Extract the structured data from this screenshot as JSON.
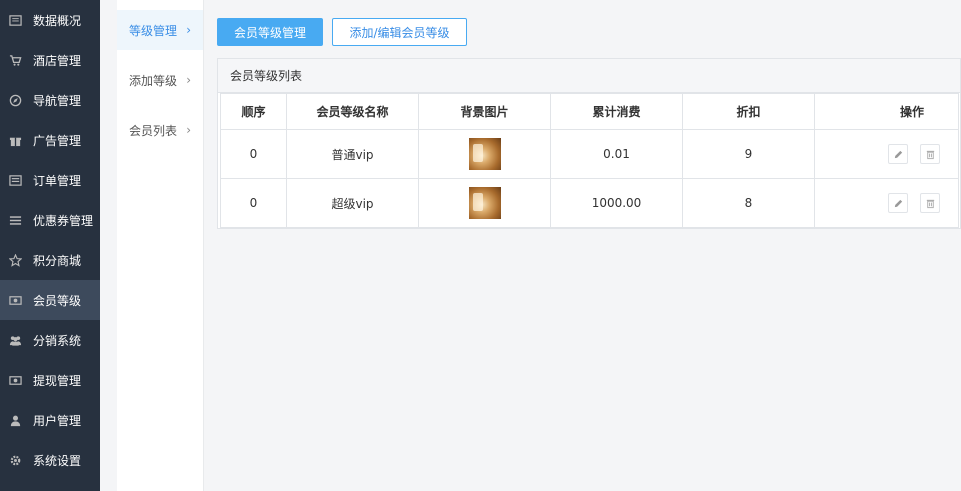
{
  "sidebar": {
    "items": [
      {
        "label": "数据概况",
        "icon": "dashboard-icon",
        "active": false
      },
      {
        "label": "酒店管理",
        "icon": "cart-icon",
        "active": false
      },
      {
        "label": "导航管理",
        "icon": "compass-icon",
        "active": false
      },
      {
        "label": "广告管理",
        "icon": "gift-icon",
        "active": false
      },
      {
        "label": "订单管理",
        "icon": "list-icon",
        "active": false
      },
      {
        "label": "优惠券管理",
        "icon": "menu-icon",
        "active": false
      },
      {
        "label": "积分商城",
        "icon": "star-icon",
        "active": false
      },
      {
        "label": "会员等级",
        "icon": "money-icon",
        "active": true
      },
      {
        "label": "分销系统",
        "icon": "users-icon",
        "active": false
      },
      {
        "label": "提现管理",
        "icon": "money-icon",
        "active": false
      },
      {
        "label": "用户管理",
        "icon": "user-icon",
        "active": false
      },
      {
        "label": "系统设置",
        "icon": "gear-icon",
        "active": false
      }
    ]
  },
  "subnav": {
    "items": [
      {
        "label": "等级管理",
        "active": true
      },
      {
        "label": "添加等级",
        "active": false
      },
      {
        "label": "会员列表",
        "active": false
      }
    ]
  },
  "toolbar": {
    "primary_label": "会员等级管理",
    "secondary_label": "添加/编辑会员等级"
  },
  "panel": {
    "title": "会员等级列表",
    "columns": [
      "顺序",
      "会员等级名称",
      "背景图片",
      "累计消费",
      "折扣",
      "操作"
    ],
    "rows": [
      {
        "order": "0",
        "name": "普通vip",
        "spend": "0.01",
        "discount": "9"
      },
      {
        "order": "0",
        "name": "超级vip",
        "spend": "1000.00",
        "discount": "8"
      }
    ]
  },
  "colors": {
    "sidebar_bg": "#27313f",
    "sidebar_active": "#3d4a5c",
    "accent": "#48aaf2"
  }
}
